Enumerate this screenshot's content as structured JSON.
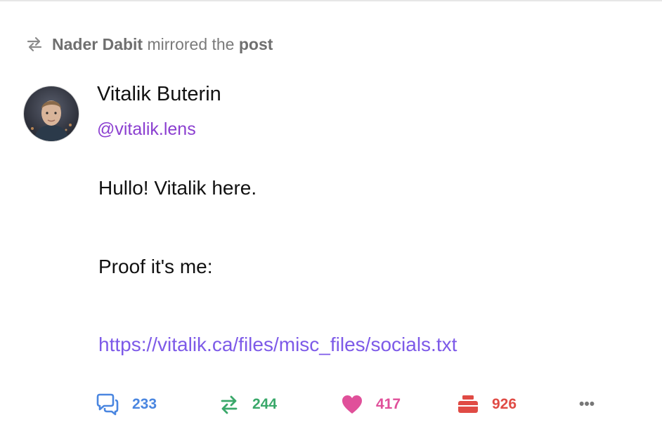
{
  "mirror_notice": {
    "icon": "mirror-arrows-icon",
    "user": "Nader Dabit",
    "action": "mirrored the",
    "object": "post"
  },
  "post": {
    "author_name": "Vitalik Buterin",
    "author_handle": "@vitalik.lens",
    "lines": [
      "Hullo! Vitalik here.",
      "Proof it's me:"
    ],
    "link": "https://vitalik.ca/files/misc_files/socials.txt"
  },
  "actions": {
    "comments": "233",
    "mirrors": "244",
    "likes": "417",
    "collects": "926",
    "more": "•••"
  },
  "colors": {
    "comment": "#4a86e0",
    "mirror": "#3aa86a",
    "like": "#e0509a",
    "collect": "#e04b45",
    "handle": "#8b3fd0",
    "link": "#7d5ae8"
  }
}
